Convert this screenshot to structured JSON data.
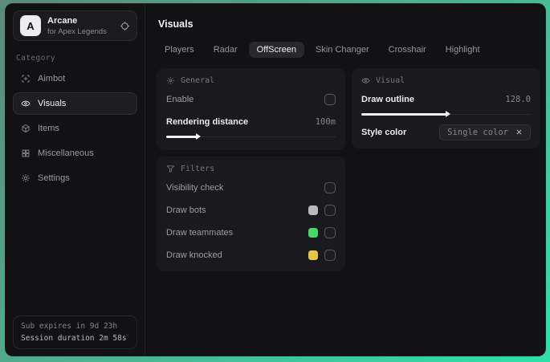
{
  "app": {
    "name": "Arcane",
    "tagline": "for Apex Legends",
    "logo_letter": "A"
  },
  "sidebar": {
    "category_label": "Category",
    "items": [
      {
        "label": "Aimbot",
        "icon": "crosshair-icon"
      },
      {
        "label": "Visuals",
        "icon": "eye-icon"
      },
      {
        "label": "Items",
        "icon": "cube-icon"
      },
      {
        "label": "Miscellaneous",
        "icon": "grid-icon"
      },
      {
        "label": "Settings",
        "icon": "gear-icon"
      }
    ],
    "footer": {
      "sub_expires": "Sub expires in 9d 23h",
      "session_duration": "Session duration 2m 58s"
    }
  },
  "main": {
    "title": "Visuals",
    "tabs": [
      {
        "label": "Players"
      },
      {
        "label": "Radar"
      },
      {
        "label": "OffScreen"
      },
      {
        "label": "Skin Changer"
      },
      {
        "label": "Crosshair"
      },
      {
        "label": "Highlight"
      }
    ],
    "selected_tab": "OffScreen",
    "panels": {
      "general": {
        "title": "General",
        "enable_label": "Enable",
        "enable_checked": false,
        "rendering_label": "Rendering distance",
        "rendering_value": "100m",
        "rendering_percent": 18
      },
      "visual": {
        "title": "Visual",
        "outline_label": "Draw outline",
        "outline_value": "128.0",
        "outline_percent": 50,
        "style_label": "Style color",
        "style_value": "Single color"
      },
      "filters": {
        "title": "Filters",
        "rows": [
          {
            "label": "Visibility check",
            "swatch": "",
            "checked": false
          },
          {
            "label": "Draw bots",
            "swatch": "#b8b8b8",
            "checked": false
          },
          {
            "label": "Draw teammates",
            "swatch": "#46d868",
            "checked": false
          },
          {
            "label": "Draw knocked",
            "swatch": "#e5c648",
            "checked": false
          }
        ]
      }
    }
  },
  "colors": {
    "background_accent_top": "#5d8a7a",
    "background_accent_bottom": "#2de0a8",
    "swatch_bots": "#b8b8b8",
    "swatch_teammates": "#46d868",
    "swatch_knocked": "#e5c648"
  }
}
